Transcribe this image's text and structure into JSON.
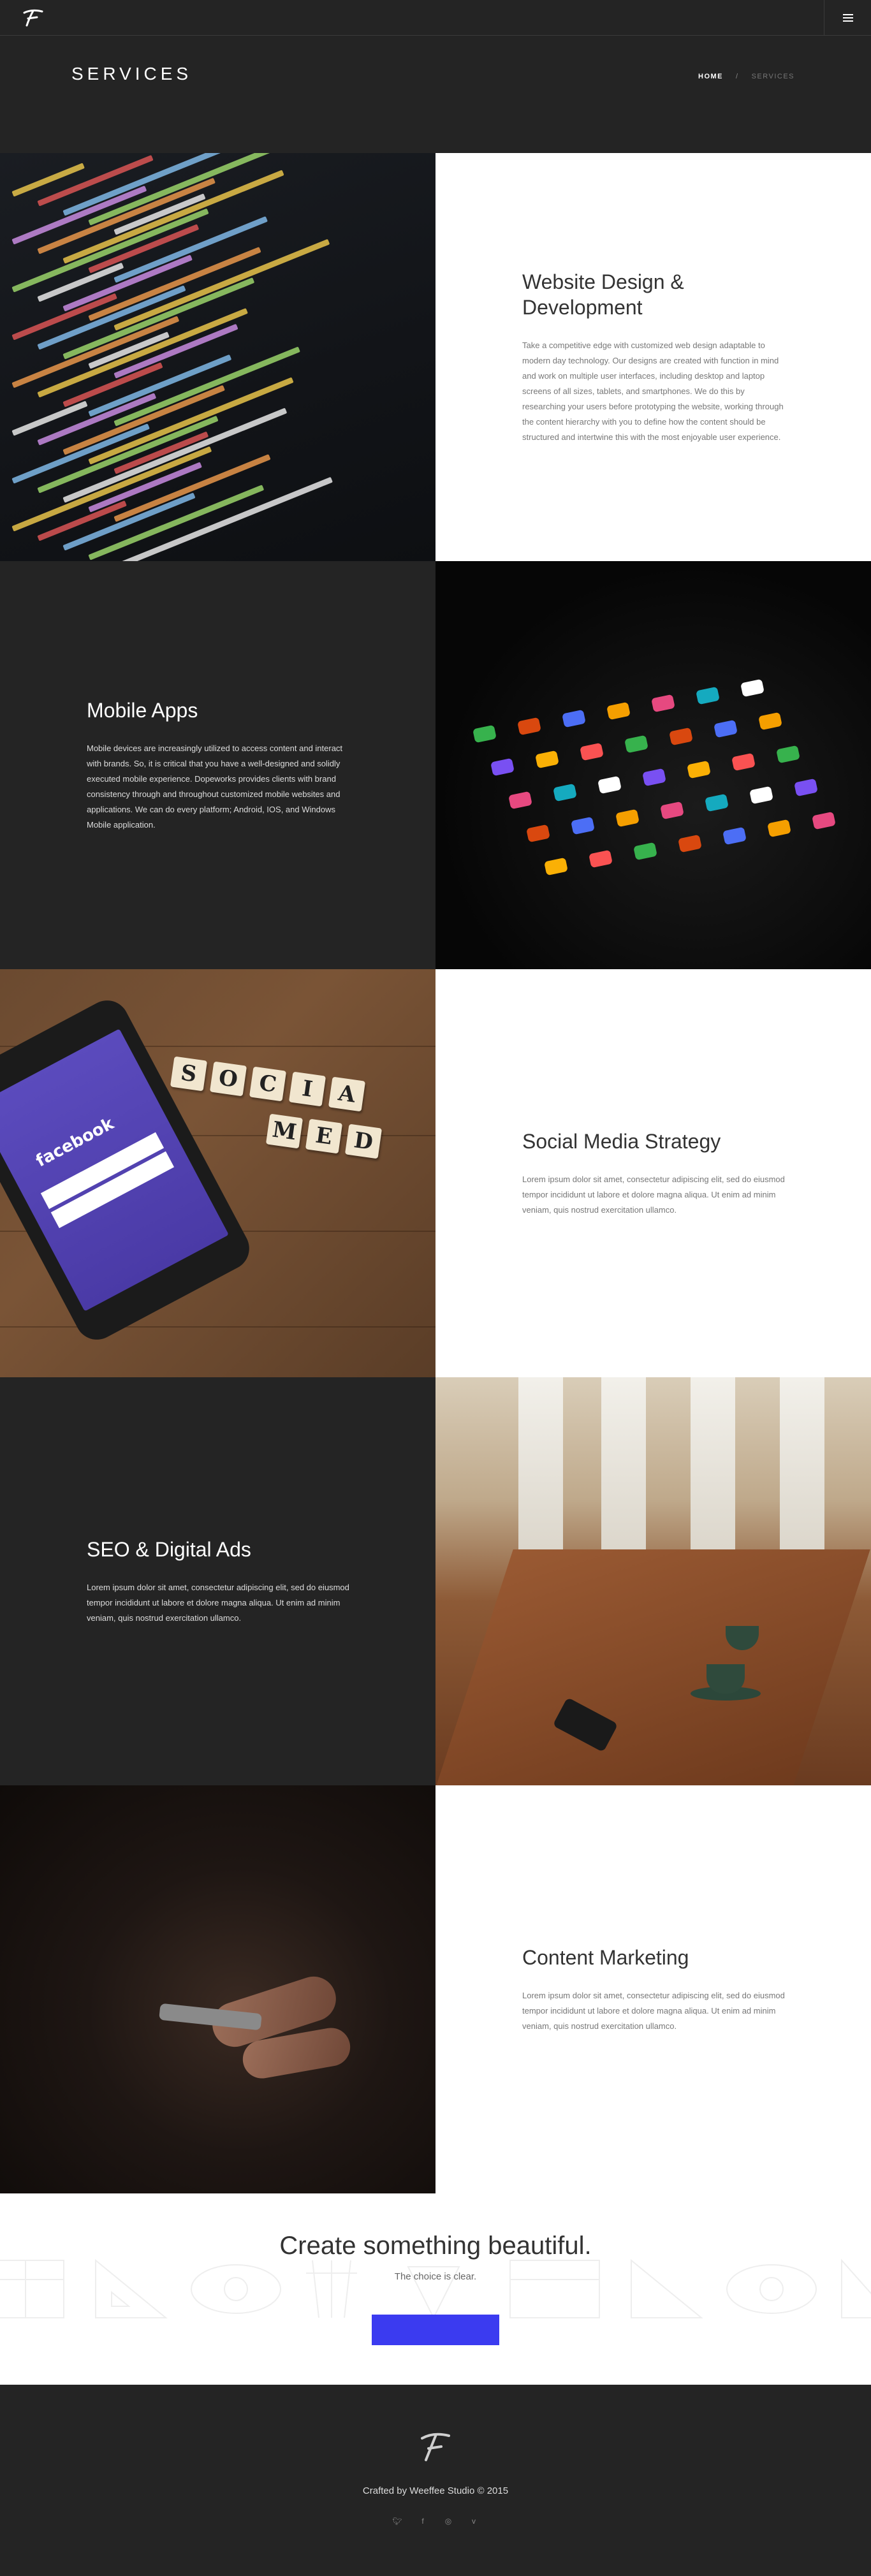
{
  "header": {
    "page_title": "SERVICES",
    "breadcrumb": {
      "home": "HOME",
      "separator": "/",
      "current": "SERVICES"
    }
  },
  "services": [
    {
      "title": "Website Design & Development",
      "description": "Take a competitive edge with customized web design adaptable to modern day technology. Our designs are created with function in mind and work on multiple user interfaces, including desktop and laptop screens of all sizes, tablets, and smartphones. We do this by researching your users before prototyping the website, working through the content hierarchy with you to define how the content should be structured and intertwine this with the most enjoyable user experience."
    },
    {
      "title": "Mobile Apps",
      "description": "Mobile devices are increasingly utilized to access content and interact with brands. So, it is critical that you have a well-designed and solidly executed mobile experience. Dopeworks provides clients with brand consistency through and throughout customized mobile websites and applications. We can do every platform; Android, IOS, and Windows Mobile application."
    },
    {
      "title": "Social Media Strategy",
      "description": "Lorem ipsum dolor sit amet, consectetur adipiscing elit, sed do eiusmod tempor incididunt ut labore et dolore magna aliqua. Ut enim ad minim veniam, quis nostrud exercitation ullamco."
    },
    {
      "title": "SEO & Digital Ads",
      "description": "Lorem ipsum dolor sit amet, consectetur adipiscing elit, sed do eiusmod tempor incididunt ut labore et dolore magna aliqua. Ut enim ad minim veniam, quis nostrud exercitation ullamco."
    },
    {
      "title": "Content Marketing",
      "description": "Lorem ipsum dolor sit amet, consectetur adipiscing elit, sed do eiusmod tempor incididunt ut labore et dolore magna aliqua. Ut enim ad minim veniam, quis nostrud exercitation ullamco."
    }
  ],
  "images": {
    "facebook_word": "facebook",
    "scrabble_row1": [
      "S",
      "O",
      "C",
      "I",
      "A"
    ],
    "scrabble_row2": [
      "M",
      "E",
      "D"
    ]
  },
  "cta": {
    "title": "Create something beautiful.",
    "subtitle": "The choice is clear.",
    "button_label": ""
  },
  "footer": {
    "credit": "Crafted by Weeffee Studio © 2015",
    "socials": [
      "twitter-icon",
      "facebook-icon",
      "instagram-icon",
      "vimeo-icon"
    ]
  },
  "colors": {
    "dark_bg": "#242424",
    "light_bg": "#ffffff",
    "cta_button": "#3b3bf0"
  }
}
